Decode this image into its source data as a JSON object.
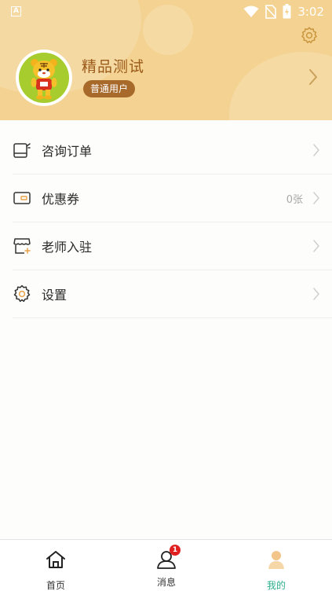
{
  "status_bar": {
    "time": "3:02",
    "notif_icon": "A"
  },
  "profile": {
    "name": "精品测试",
    "badge": "普通用户"
  },
  "menu": [
    {
      "label": "咨询订单",
      "extra": "",
      "icon": "order-icon"
    },
    {
      "label": "优惠券",
      "extra": "0张",
      "icon": "coupon-icon"
    },
    {
      "label": "老师入驻",
      "extra": "",
      "icon": "store-icon"
    },
    {
      "label": "设置",
      "extra": "",
      "icon": "settings-icon"
    }
  ],
  "tabbar": [
    {
      "label": "首页",
      "icon": "home-icon",
      "active": false
    },
    {
      "label": "消息",
      "icon": "message-user-icon",
      "active": false,
      "badge": "1"
    },
    {
      "label": "我的",
      "icon": "profile-icon",
      "active": true
    }
  ],
  "colors": {
    "header_bg": "#f4d291",
    "badge_bg": "#a86a2a",
    "name": "#9a5a1a",
    "tab_active": "#2cae8c",
    "notify": "#e02020"
  }
}
